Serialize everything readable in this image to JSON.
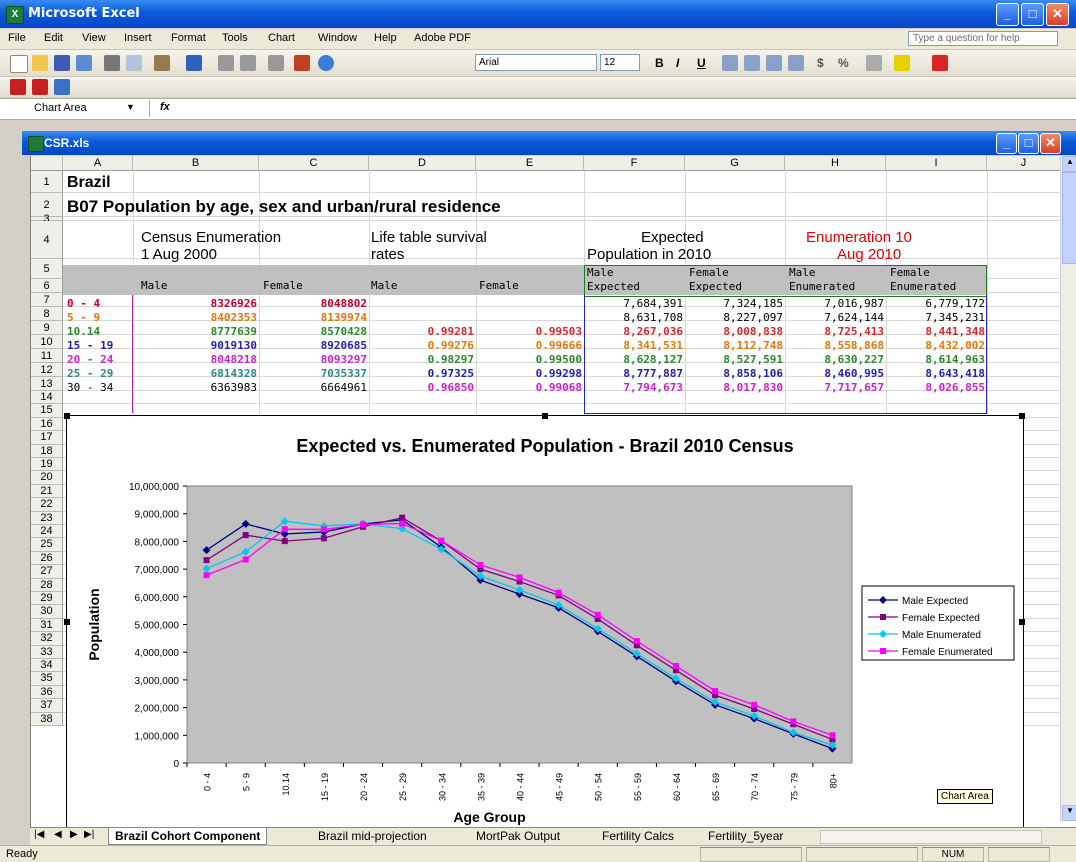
{
  "app": {
    "title": "Microsoft Excel",
    "icon_name": "excel-icon"
  },
  "menu": [
    "File",
    "Edit",
    "View",
    "Insert",
    "Format",
    "Tools",
    "Chart",
    "Window",
    "Help",
    "Adobe PDF"
  ],
  "ask_placeholder": "Type a question for help",
  "toolbar": {
    "font": "Arial",
    "size": "12",
    "bold": "B",
    "italic": "I",
    "underline": "U",
    "currency": "$",
    "percent": "%"
  },
  "formula": {
    "namebox": "Chart Area",
    "fx": "fx",
    "content": ""
  },
  "workbook": {
    "title": "CSR.xls",
    "columns": [
      "A",
      "B",
      "C",
      "D",
      "E",
      "F",
      "G",
      "H",
      "I",
      "J"
    ],
    "rows": [
      "1",
      "2",
      "3",
      "4",
      "5",
      "6",
      "7",
      "8",
      "9",
      "10",
      "11",
      "12",
      "13",
      "14",
      "15",
      "16",
      "17",
      "18",
      "19",
      "20",
      "21",
      "22",
      "23",
      "24",
      "25",
      "26",
      "27",
      "28",
      "29",
      "30",
      "31",
      "32",
      "33",
      "34",
      "35",
      "36",
      "37",
      "38"
    ],
    "a1": "Brazil",
    "a2": "B07 Population by age, sex and urban/rural residence",
    "h_census": "Census Enumeration",
    "h_census2": "1 Aug 2000",
    "h_life": "Life table survival",
    "h_life2": "rates",
    "h_expected": "Expected",
    "h_expected2": "Population in 2010",
    "h_enum": "Enumeration 10",
    "h_enum2": "Aug 2010",
    "sub": {
      "b": "Male",
      "c": "Female",
      "d": "Male",
      "e": "Female",
      "f1": "Male",
      "f2": "Expected",
      "g1": "Female",
      "g2": "Expected",
      "h1": "Male",
      "h2": "Enumerated",
      "i1": "Female",
      "i2": "Enumerated"
    },
    "data_rows": [
      {
        "age": "0 - 4",
        "b": "8326926",
        "c": "8048802",
        "d": "",
        "e": "",
        "f": "7,684,391",
        "g": "7,324,185",
        "h": "7,016,987",
        "i": "6,779,172",
        "color": "#c0002b"
      },
      {
        "age": "5 - 9",
        "b": "8402353",
        "c": "8139974",
        "d": "",
        "e": "",
        "f": "8,631,708",
        "g": "8,227,097",
        "h": "7,624,144",
        "i": "7,345,231",
        "color": "#e0780a"
      },
      {
        "age": "10.14",
        "b": "8777639",
        "c": "8570428",
        "d": "0.99281",
        "e": "0.99503",
        "f": "8,267,036",
        "g": "8,008,838",
        "h": "8,725,413",
        "i": "8,441,348",
        "color": "#2a8a2a"
      },
      {
        "age": "15 - 19",
        "b": "9019130",
        "c": "8920685",
        "d": "0.99276",
        "e": "0.99666",
        "f": "8,341,531",
        "g": "8,112,748",
        "h": "8,558,868",
        "i": "8,432,002",
        "color": "#1f1fb0"
      },
      {
        "age": "20 - 24",
        "b": "8048218",
        "c": "8093297",
        "d": "0.98297",
        "e": "0.99500",
        "f": "8,628,127",
        "g": "8,527,591",
        "h": "8,630,227",
        "i": "8,614,963",
        "color": "#cc22cc"
      },
      {
        "age": "25 - 29",
        "b": "6814328",
        "c": "7035337",
        "d": "0.97325",
        "e": "0.99298",
        "f": "8,777,887",
        "g": "8,858,106",
        "h": "8,460,995",
        "i": "8,643,418",
        "color": "#2a8a8a"
      },
      {
        "age": "30 - 34",
        "b": "6363983",
        "c": "6664961",
        "d": "0.96850",
        "e": "0.99068",
        "f": "7,794,673",
        "g": "8,017,830",
        "h": "7,717,657",
        "i": "8,026,855",
        "color": "#000000"
      }
    ],
    "row_colors": {
      "d": [
        "",
        "",
        "#d6282b",
        "#e0780a",
        "#2a8a2a",
        "#1f1fb0",
        "#cc22cc"
      ],
      "f": [
        "#000000",
        "#000000",
        "#d6282b",
        "#e0780a",
        "#2a8a2a",
        "#1f1fb0",
        "#cc22cc"
      ],
      "h": [
        "#000000",
        "#000000",
        "#d6282b",
        "#e0780a",
        "#2a8a2a",
        "#1f1fb0",
        "#cc22cc"
      ]
    }
  },
  "chart_data": {
    "type": "line",
    "title": "Expected vs. Enumerated Population - Brazil 2010 Census",
    "xlabel": "Age Group",
    "ylabel": "Population",
    "ylim": [
      0,
      10000000
    ],
    "yticks": [
      "0",
      "1,000,000",
      "2,000,000",
      "3,000,000",
      "4,000,000",
      "5,000,000",
      "6,000,000",
      "7,000,000",
      "8,000,000",
      "9,000,000",
      "10,000,000"
    ],
    "categories": [
      "0 - 4",
      "5 - 9",
      "10.14",
      "15 - 19",
      "20 - 24",
      "25 - 29",
      "30 - 34",
      "35 - 39",
      "40 - 44",
      "45 - 49",
      "50 - 54",
      "55 - 59",
      "60 - 64",
      "65 - 69",
      "70 - 74",
      "75 - 79",
      "80+"
    ],
    "grid": false,
    "legend": "right",
    "series": [
      {
        "name": "Male Expected",
        "color": "#000080",
        "marker": "diamond",
        "values": [
          7684391,
          8631708,
          8267036,
          8341531,
          8628127,
          8777887,
          7794673,
          6600000,
          6100000,
          5600000,
          4750000,
          3850000,
          2950000,
          2100000,
          1600000,
          1050000,
          520000
        ]
      },
      {
        "name": "Female Expected",
        "color": "#800080",
        "marker": "square",
        "values": [
          7324185,
          8227097,
          8008838,
          8112748,
          8527591,
          8858106,
          8017830,
          7000000,
          6550000,
          6050000,
          5200000,
          4250000,
          3350000,
          2450000,
          1950000,
          1400000,
          850000
        ]
      },
      {
        "name": "Male Enumerated",
        "color": "#00c8f0",
        "marker": "diamond",
        "values": [
          7016987,
          7624144,
          8725413,
          8558868,
          8630227,
          8460995,
          7717657,
          6750000,
          6250000,
          5700000,
          4850000,
          3950000,
          3050000,
          2200000,
          1700000,
          1100000,
          650000
        ]
      },
      {
        "name": "Female Enumerated",
        "color": "#ff00ff",
        "marker": "square",
        "values": [
          6779172,
          7345231,
          8441348,
          8432002,
          8614963,
          8643418,
          8026855,
          7150000,
          6700000,
          6150000,
          5350000,
          4400000,
          3500000,
          2600000,
          2100000,
          1500000,
          1000000
        ]
      }
    ],
    "tooltip": "Chart Area"
  },
  "tabs": [
    "Brazil Cohort Component",
    "Brazil mid-projection",
    "MortPak Output",
    "Fertility Calcs",
    "Fertility_5year"
  ],
  "status": {
    "left": "Ready",
    "num": "NUM"
  }
}
